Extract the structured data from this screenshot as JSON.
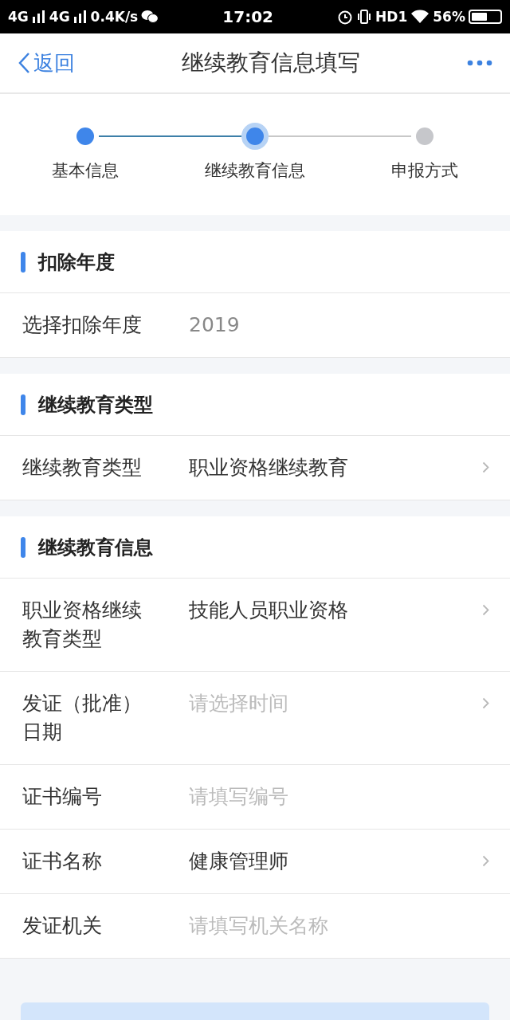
{
  "status_bar": {
    "network_1": "4G",
    "network_2": "4G",
    "speed": "0.4K/s",
    "time": "17:02",
    "hd": "HD1",
    "battery": "56%"
  },
  "nav": {
    "back": "返回",
    "title": "继续教育信息填写"
  },
  "steps": [
    {
      "label": "基本信息",
      "completed": true,
      "selected": false
    },
    {
      "label": "继续教育信息",
      "completed": false,
      "selected": true
    },
    {
      "label": "申报方式",
      "completed": false,
      "selected": false
    }
  ],
  "sections": [
    {
      "title": "扣除年度",
      "rows": [
        {
          "label": "选择扣除年度",
          "kind": "readonly",
          "value": "2019"
        }
      ]
    },
    {
      "title": "继续教育类型",
      "rows": [
        {
          "label": "继续教育类型",
          "kind": "select",
          "value": "职业资格继续教育"
        }
      ]
    },
    {
      "title": "继续教育信息",
      "rows": [
        {
          "label": "职业资格继续教育类型",
          "kind": "select",
          "value": "技能人员职业资格"
        },
        {
          "label": "发证（批准）日期",
          "kind": "select",
          "placeholder": "请选择时间"
        },
        {
          "label": "证书编号",
          "kind": "input",
          "placeholder": "请填写编号"
        },
        {
          "label": "证书名称",
          "kind": "select",
          "value": "健康管理师"
        },
        {
          "label": "发证机关",
          "kind": "input",
          "placeholder": "请填写机关名称"
        }
      ]
    }
  ]
}
